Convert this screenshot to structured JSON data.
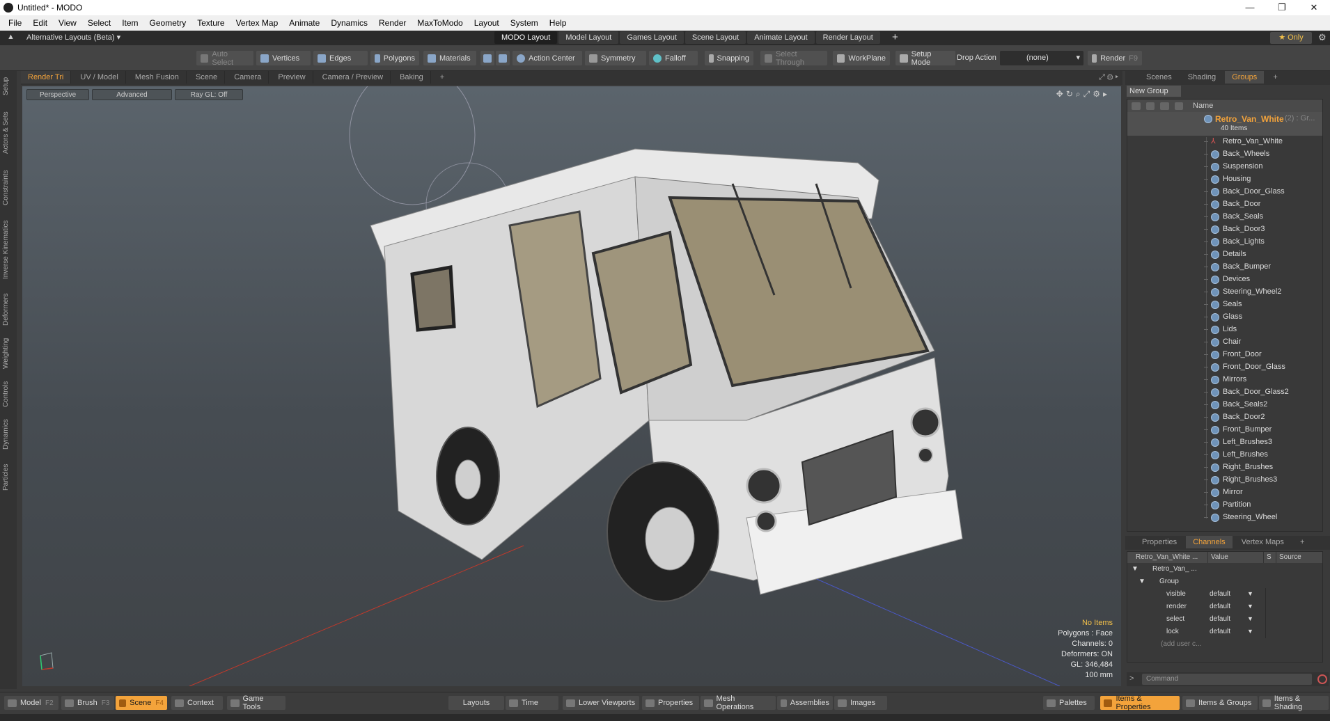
{
  "window": {
    "title": "Untitled* - MODO",
    "controls": [
      "—",
      "❐",
      "✕"
    ]
  },
  "menu": [
    "File",
    "Edit",
    "View",
    "Select",
    "Item",
    "Geometry",
    "Texture",
    "Vertex Map",
    "Animate",
    "Dynamics",
    "Render",
    "MaxToModo",
    "Layout",
    "System",
    "Help"
  ],
  "layoutbar": {
    "alt_layouts": "Alternative Layouts (Beta) ▾",
    "tabs": [
      "MODO Layout",
      "Model Layout",
      "Games Layout",
      "Scene Layout",
      "Animate Layout",
      "Render Layout"
    ],
    "active_tab": "MODO Layout",
    "plus": "+",
    "only": "★ Only"
  },
  "toolbar": {
    "auto_select": "Auto Select",
    "vertices": "Vertices",
    "edges": "Edges",
    "polygons": "Polygons",
    "materials": "Materials",
    "action_center": "Action Center",
    "symmetry": "Symmetry",
    "falloff": "Falloff",
    "snapping": "Snapping",
    "select_through": "Select Through",
    "workplane": "WorkPlane",
    "setup_mode": "Setup Mode",
    "drop_action": "Drop Action",
    "drop_value": "(none)",
    "render": "Render",
    "render_key": "F9"
  },
  "left_tabs": [
    "Setup",
    "Actors & Sets",
    "Constraints",
    "Inverse Kinematics",
    "Deformers",
    "Weighting",
    "Controls",
    "Dynamics",
    "Particles"
  ],
  "viewport_tabs": [
    "Render Tri",
    "UV / Model",
    "Mesh Fusion",
    "Scene",
    "Camera",
    "Preview",
    "Camera / Preview",
    "Baking",
    "+"
  ],
  "viewport": {
    "perspective": "Perspective",
    "advanced": "Advanced",
    "raygl": "Ray GL: Off",
    "info": [
      "No Items",
      "Polygons : Face",
      "Channels: 0",
      "Deformers: ON",
      "GL: 346,484",
      "100 mm"
    ]
  },
  "right_tabs": [
    "Scenes",
    "Shading",
    "Groups",
    "+"
  ],
  "groups": {
    "new_group": "New Group",
    "name_header": "Name",
    "root_name": "Retro_Van_White",
    "root_suffix": "(2) : Gr...",
    "root_count": "40 Items",
    "items": [
      "Retro_Van_White",
      "Back_Wheels",
      "Suspension",
      "Housing",
      "Back_Door_Glass",
      "Back_Door",
      "Back_Seals",
      "Back_Door3",
      "Back_Lights",
      "Details",
      "Back_Bumper",
      "Devices",
      "Steering_Wheel2",
      "Seals",
      "Glass",
      "Lids",
      "Chair",
      "Front_Door",
      "Front_Door_Glass",
      "Mirrors",
      "Back_Door_Glass2",
      "Back_Seals2",
      "Back_Door2",
      "Front_Bumper",
      "Left_Brushes3",
      "Left_Brushes",
      "Right_Brushes",
      "Right_Brushes3",
      "Mirror",
      "Partition",
      "Steering_Wheel"
    ]
  },
  "properties_tabs": [
    "Properties",
    "Channels",
    "Vertex Maps",
    "+"
  ],
  "channels": {
    "headers": [
      "Retro_Van_White ...",
      "Value",
      "S",
      "Source"
    ],
    "root": "Retro_Van_ ...",
    "group": "Group",
    "rows": [
      {
        "label": "visible",
        "value": "default"
      },
      {
        "label": "render",
        "value": "default"
      },
      {
        "label": "select",
        "value": "default"
      },
      {
        "label": "lock",
        "value": "default"
      }
    ],
    "add_user": "(add user c..."
  },
  "command": {
    "caret": ">",
    "placeholder": "Command"
  },
  "bottom": {
    "model": "Model",
    "model_key": "F2",
    "brush": "Brush",
    "brush_key": "F3",
    "scene": "Scene",
    "scene_key": "F4",
    "context": "Context",
    "game_tools": "Game Tools",
    "layouts": "Layouts",
    "time": "Time",
    "lower_viewports": "Lower Viewports",
    "properties": "Properties",
    "mesh_operations": "Mesh Operations",
    "assemblies": "Assemblies",
    "images": "Images",
    "palettes": "Palettes",
    "items_properties": "Items & Properties",
    "items_groups": "Items & Groups",
    "items_shading": "Items & Shading"
  }
}
